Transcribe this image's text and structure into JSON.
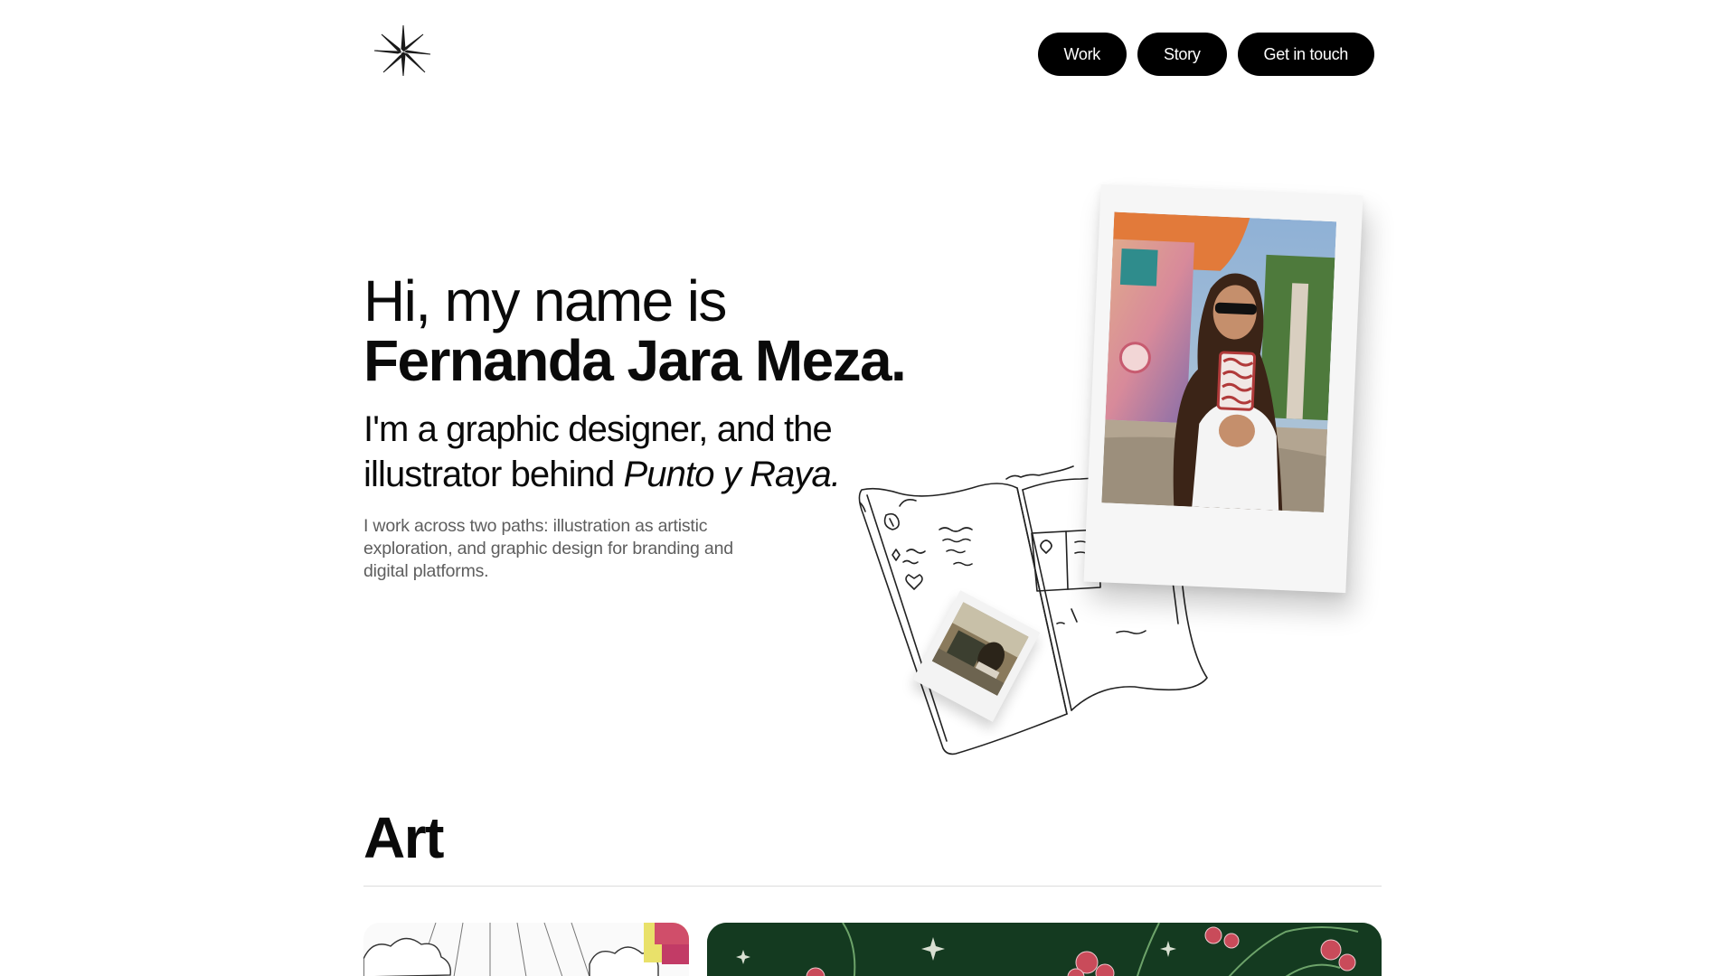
{
  "header": {
    "logo_icon": "eight-point-star-icon",
    "nav": [
      {
        "label": "Work"
      },
      {
        "label": "Story"
      },
      {
        "label": "Get in touch"
      }
    ]
  },
  "hero": {
    "greeting": "Hi, my name is",
    "name": "Fernanda Jara Meza.",
    "role_prefix": "I'm a graphic designer, and the illustrator behind ",
    "role_project": "Punto y Raya.",
    "intro": "I work across two paths: illustration as artistic exploration, and graphic design for branding and digital platforms."
  },
  "art_section": {
    "title": "Art"
  },
  "colors": {
    "button_bg": "#000000",
    "button_text": "#ffffff",
    "body_text": "#0a0a0a",
    "muted_text": "#5e5e5e",
    "divider": "#dddddd",
    "art_card_green": "#143a20"
  }
}
